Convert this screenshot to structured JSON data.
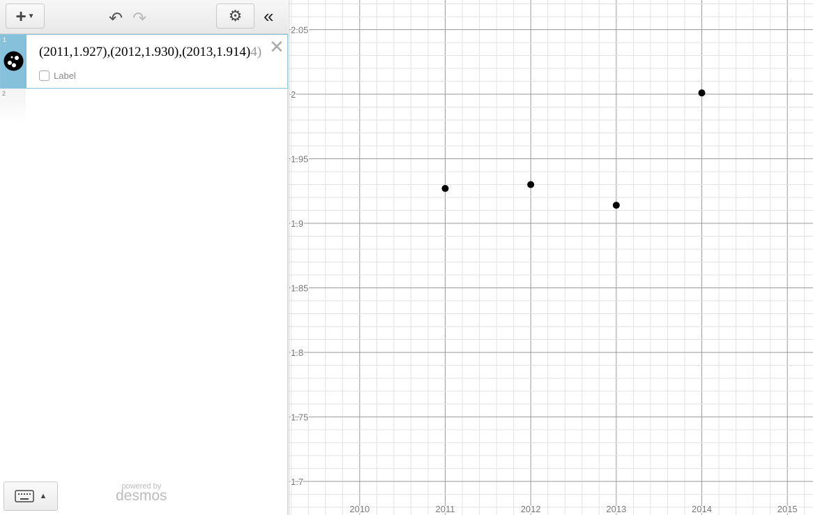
{
  "toolbar": {
    "add_icon": "plus-dropdown-icon",
    "undo_icon": "undo-icon",
    "redo_icon": "redo-icon",
    "settings_icon": "gear-icon",
    "collapse_icon": "double-chevron-left-icon"
  },
  "expressions": [
    {
      "index": "1",
      "latex": "(2011,1.927),(2012,1.930),(2013,1.914)",
      "latex_faded_tail": "4)",
      "label_checkbox": "Label",
      "icon": "point-cluster-icon",
      "color": "#000000"
    },
    {
      "index": "2",
      "latex": ""
    }
  ],
  "footer": {
    "keyboard_icon": "keyboard-icon",
    "powered_by": "powered by",
    "brand": "desmos"
  },
  "chart_data": {
    "type": "scatter",
    "x": [
      2011,
      2012,
      2013,
      2014
    ],
    "y": [
      1.927,
      1.93,
      1.914,
      2.001
    ],
    "xlim": [
      2009.17,
      2015.3
    ],
    "ylim": [
      1.674,
      2.073
    ],
    "x_ticks": [
      "2010",
      "2011",
      "2012",
      "2013",
      "2014",
      "2015"
    ],
    "y_ticks": [
      "1.7",
      "1.75",
      "1.8",
      "1.85",
      "1.9",
      "1.95",
      "2",
      "2.05"
    ],
    "grid": true,
    "point_color": "#000000"
  }
}
